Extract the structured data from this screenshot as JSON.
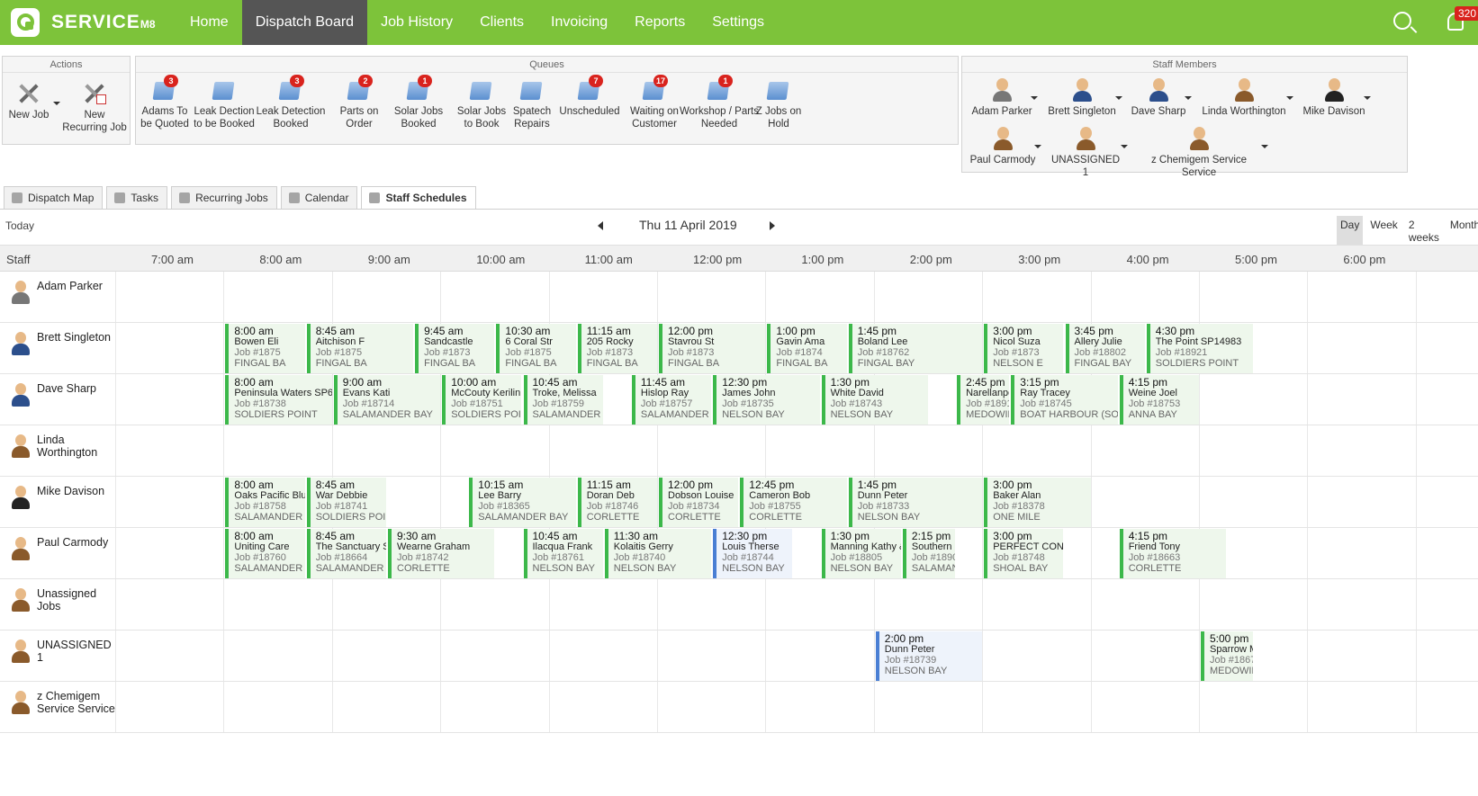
{
  "topbar": {
    "brand": "SERVICE",
    "brand_suffix": "M8",
    "nav": [
      "Home",
      "Dispatch Board",
      "Job History",
      "Clients",
      "Invoicing",
      "Reports",
      "Settings"
    ],
    "active_nav": "Dispatch Board",
    "notifications_count": "320",
    "accent_color": "#7dc33a"
  },
  "actions": {
    "title": "Actions",
    "new_job": "New Job",
    "new_recurring_job": "New Recurring Job"
  },
  "queues": {
    "title": "Queues",
    "items": [
      {
        "label": "Adams To be Quoted",
        "count": "3"
      },
      {
        "label": "Leak Dection to be Booked",
        "count": ""
      },
      {
        "label": "Leak Detection Booked",
        "count": "3"
      },
      {
        "label": "Parts on Order",
        "count": "2"
      },
      {
        "label": "Solar Jobs Booked",
        "count": "1"
      },
      {
        "label": "Solar Jobs to Book",
        "count": ""
      },
      {
        "label": "Spatech Repairs",
        "count": ""
      },
      {
        "label": "Unscheduled",
        "count": "7"
      },
      {
        "label": "Waiting on Customer",
        "count": "17"
      },
      {
        "label": "Workshop / Parts Needed",
        "count": "1"
      },
      {
        "label": "Z Jobs on Hold",
        "count": ""
      }
    ]
  },
  "staff_members": {
    "title": "Staff Members",
    "items": [
      "Adam Parker",
      "Brett Singleton",
      "Dave Sharp",
      "Linda Worthington",
      "Mike Davison",
      "Paul Carmody",
      "UNASSIGNED 1",
      "z Chemigem Service Service"
    ]
  },
  "tabs": [
    "Dispatch Map",
    "Tasks",
    "Recurring Jobs",
    "Calendar",
    "Staff Schedules"
  ],
  "active_tab": "Staff Schedules",
  "schedule": {
    "today_label": "Today",
    "current_date": "Thu 11 April 2019",
    "views": [
      "Day",
      "Week",
      "2 weeks",
      "Month"
    ],
    "active_view": "Day",
    "staff_col_label": "Staff",
    "hours": [
      "7:00 am",
      "8:00 am",
      "9:00 am",
      "10:00 am",
      "11:00 am",
      "12:00 pm",
      "1:00 pm",
      "2:00 pm",
      "3:00 pm",
      "4:00 pm",
      "5:00 pm",
      "6:00 pm"
    ],
    "rows": [
      {
        "staff": "Adam Parker",
        "jobs": []
      },
      {
        "staff": "Brett Singleton",
        "jobs": [
          {
            "time": "8:00 am",
            "name": "Bowen Eli",
            "job": "Job #1875",
            "loc": "FINGAL BA",
            "start": 8.0,
            "end": 8.75
          },
          {
            "time": "8:45 am",
            "name": "Aitchison F",
            "job": "Job #1875",
            "loc": "FINGAL BA",
            "start": 8.75,
            "end": 9.75
          },
          {
            "time": "9:45 am",
            "name": "Sandcastle",
            "job": "Job #1873",
            "loc": "FINGAL BA",
            "start": 9.75,
            "end": 10.5
          },
          {
            "time": "10:30 am",
            "name": "6 Coral Str",
            "job": "Job #1875",
            "loc": "FINGAL BA",
            "start": 10.5,
            "end": 11.25
          },
          {
            "time": "11:15 am",
            "name": "205 Rocky",
            "job": "Job #1873",
            "loc": "FINGAL BA",
            "start": 11.25,
            "end": 12.0
          },
          {
            "time": "12:00 pm",
            "name": "Stavrou St",
            "job": "Job #1873",
            "loc": "FINGAL BA",
            "start": 12.0,
            "end": 13.0
          },
          {
            "time": "1:00 pm",
            "name": "Gavin Ama",
            "job": "Job #1874",
            "loc": "FINGAL BA",
            "start": 13.0,
            "end": 13.75
          },
          {
            "time": "1:45 pm",
            "name": "Boland Lee",
            "job": "Job #18762",
            "loc": "FINGAL BAY",
            "start": 13.75,
            "end": 15.0
          },
          {
            "time": "3:00 pm",
            "name": "Nicol Suza",
            "job": "Job #1873",
            "loc": "NELSON E",
            "start": 15.0,
            "end": 15.75
          },
          {
            "time": "3:45 pm",
            "name": "Allery Julie",
            "job": "Job #18802",
            "loc": "FINGAL BAY",
            "start": 15.75,
            "end": 16.5
          },
          {
            "time": "4:30 pm",
            "name": "The Point SP14983",
            "job": "Job #18921",
            "loc": "SOLDIERS POINT",
            "start": 16.5,
            "end": 17.5
          }
        ]
      },
      {
        "staff": "Dave Sharp",
        "jobs": [
          {
            "time": "8:00 am",
            "name": "Peninsula Waters SP60",
            "job": "Job #18738",
            "loc": "SOLDIERS POINT",
            "start": 8.0,
            "end": 9.0
          },
          {
            "time": "9:00 am",
            "name": "Evans Kati",
            "job": "Job #18714",
            "loc": "SALAMANDER BAY",
            "start": 9.0,
            "end": 10.0
          },
          {
            "time": "10:00 am",
            "name": "McCouty Kerilin",
            "job": "Job #18751",
            "loc": "SOLDIERS POINT",
            "start": 10.0,
            "end": 10.75
          },
          {
            "time": "10:45 am",
            "name": "Troke, Melissa",
            "job": "Job #18759",
            "loc": "SALAMANDER BA",
            "start": 10.75,
            "end": 11.5
          },
          {
            "time": "11:45 am",
            "name": "Hislop Ray",
            "job": "Job #18757",
            "loc": "SALAMANDER BA",
            "start": 11.75,
            "end": 12.5
          },
          {
            "time": "12:30 pm",
            "name": "James John",
            "job": "Job #18735",
            "loc": "NELSON BAY",
            "start": 12.5,
            "end": 13.5
          },
          {
            "time": "1:30 pm",
            "name": "White David",
            "job": "Job #18743",
            "loc": "NELSON BAY",
            "start": 13.5,
            "end": 14.5
          },
          {
            "time": "2:45 pm",
            "name": "Narellanpo",
            "job": "Job #1891",
            "loc": "MEDOWIE",
            "start": 14.75,
            "end": 15.25
          },
          {
            "time": "3:15 pm",
            "name": "Ray Tracey",
            "job": "Job #18745",
            "loc": "BOAT HARBOUR (SOUT",
            "start": 15.25,
            "end": 16.25
          },
          {
            "time": "4:15 pm",
            "name": "Weine Joel",
            "job": "Job #18753",
            "loc": "ANNA BAY",
            "start": 16.25,
            "end": 17.0
          }
        ]
      },
      {
        "staff": "Linda Worthington",
        "jobs": []
      },
      {
        "staff": "Mike Davison",
        "jobs": [
          {
            "time": "8:00 am",
            "name": "Oaks Pacific Blue",
            "job": "Job #18758",
            "loc": "SALAMANDER B",
            "start": 8.0,
            "end": 8.75
          },
          {
            "time": "8:45 am",
            "name": "War Debbie",
            "job": "Job #18741",
            "loc": "SOLDIERS POINT",
            "start": 8.75,
            "end": 9.5
          },
          {
            "time": "10:15 am",
            "name": "Lee Barry",
            "job": "Job #18365",
            "loc": "SALAMANDER BAY",
            "start": 10.25,
            "end": 11.25
          },
          {
            "time": "11:15 am",
            "name": "Doran Deb",
            "job": "Job #18746",
            "loc": "CORLETTE",
            "start": 11.25,
            "end": 12.0
          },
          {
            "time": "12:00 pm",
            "name": "Dobson Louise",
            "job": "Job #18734",
            "loc": "CORLETTE",
            "start": 12.0,
            "end": 12.75
          },
          {
            "time": "12:45 pm",
            "name": "Cameron Bob",
            "job": "Job #18755",
            "loc": "CORLETTE",
            "start": 12.75,
            "end": 13.75
          },
          {
            "time": "1:45 pm",
            "name": "Dunn Peter",
            "job": "Job #18733",
            "loc": "NELSON BAY",
            "start": 13.75,
            "end": 15.0
          },
          {
            "time": "3:00 pm",
            "name": "Baker Alan",
            "job": "Job #18378",
            "loc": "ONE MILE",
            "start": 15.0,
            "end": 16.0
          }
        ]
      },
      {
        "staff": "Paul Carmody",
        "jobs": [
          {
            "time": "8:00 am",
            "name": "Uniting Care",
            "job": "Job #18760",
            "loc": "SALAMANDER B",
            "start": 8.0,
            "end": 8.75
          },
          {
            "time": "8:45 am",
            "name": "The Sanctuary SF",
            "job": "Job #18664",
            "loc": "SALAMANDER BA",
            "start": 8.75,
            "end": 9.5
          },
          {
            "time": "9:30 am",
            "name": "Wearne Graham",
            "job": "Job #18742",
            "loc": "CORLETTE",
            "start": 9.5,
            "end": 10.5
          },
          {
            "time": "10:45 am",
            "name": "Ilacqua Frank",
            "job": "Job #18761",
            "loc": "NELSON BAY",
            "start": 10.75,
            "end": 11.5
          },
          {
            "time": "11:30 am",
            "name": "Kolaitis Gerry",
            "job": "Job #18740",
            "loc": "NELSON BAY",
            "start": 11.5,
            "end": 12.5
          },
          {
            "time": "12:30 pm",
            "name": "Louis Therse",
            "job": "Job #18744",
            "loc": "NELSON BAY",
            "start": 12.5,
            "end": 13.25,
            "blue": true
          },
          {
            "time": "1:30 pm",
            "name": "Manning Kathy &",
            "job": "Job #18805",
            "loc": "NELSON BAY",
            "start": 13.5,
            "end": 14.25
          },
          {
            "time": "2:15 pm",
            "name": "Southern",
            "job": "Job #1890",
            "loc": "SALAMAN",
            "start": 14.25,
            "end": 14.75
          },
          {
            "time": "3:00 pm",
            "name": "PERFECT CONTR",
            "job": "Job #18748",
            "loc": "SHOAL BAY",
            "start": 15.0,
            "end": 15.75
          },
          {
            "time": "4:15 pm",
            "name": "Friend Tony",
            "job": "Job #18663",
            "loc": "CORLETTE",
            "start": 16.25,
            "end": 17.25
          }
        ]
      },
      {
        "staff": "Unassigned Jobs",
        "jobs": []
      },
      {
        "staff": "UNASSIGNED 1",
        "jobs": [
          {
            "time": "2:00 pm",
            "name": "Dunn Peter",
            "job": "Job #18739",
            "loc": "NELSON BAY",
            "start": 14.0,
            "end": 15.0,
            "blue": true
          },
          {
            "time": "5:00 pm",
            "name": "Sparrow M",
            "job": "Job #1867",
            "loc": "MEDOWIE",
            "start": 17.0,
            "end": 17.5
          }
        ]
      },
      {
        "staff": "z Chemigem Service Service",
        "jobs": []
      }
    ]
  }
}
